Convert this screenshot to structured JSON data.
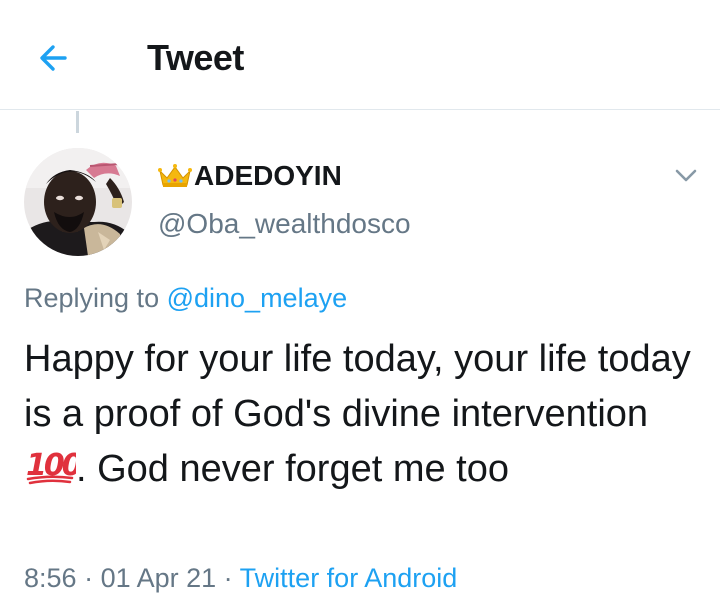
{
  "header": {
    "title": "Tweet",
    "back_icon": "arrow-left-icon"
  },
  "colors": {
    "accent": "#1da1f2",
    "secondary_text": "#657786",
    "primary_text": "#14171a",
    "divider": "#e1e8ed"
  },
  "tweet": {
    "author": {
      "crown_icon": "crown-emoji-icon",
      "display_name": "ADEDOYIN",
      "handle": "@Oba_wealthdosco"
    },
    "menu_icon": "chevron-down-icon",
    "replying_prefix": "Replying to ",
    "replying_to": "@dino_melaye",
    "text_before_emoji": "Happy for your life today, your life today is a proof of God's divine intervention ",
    "emoji_icon": "hundred-points-emoji-icon",
    "text_after_emoji": ". God never forget me too",
    "time": "8:56",
    "separator": " · ",
    "date": "01 Apr 21",
    "source": "Twitter for Android"
  }
}
